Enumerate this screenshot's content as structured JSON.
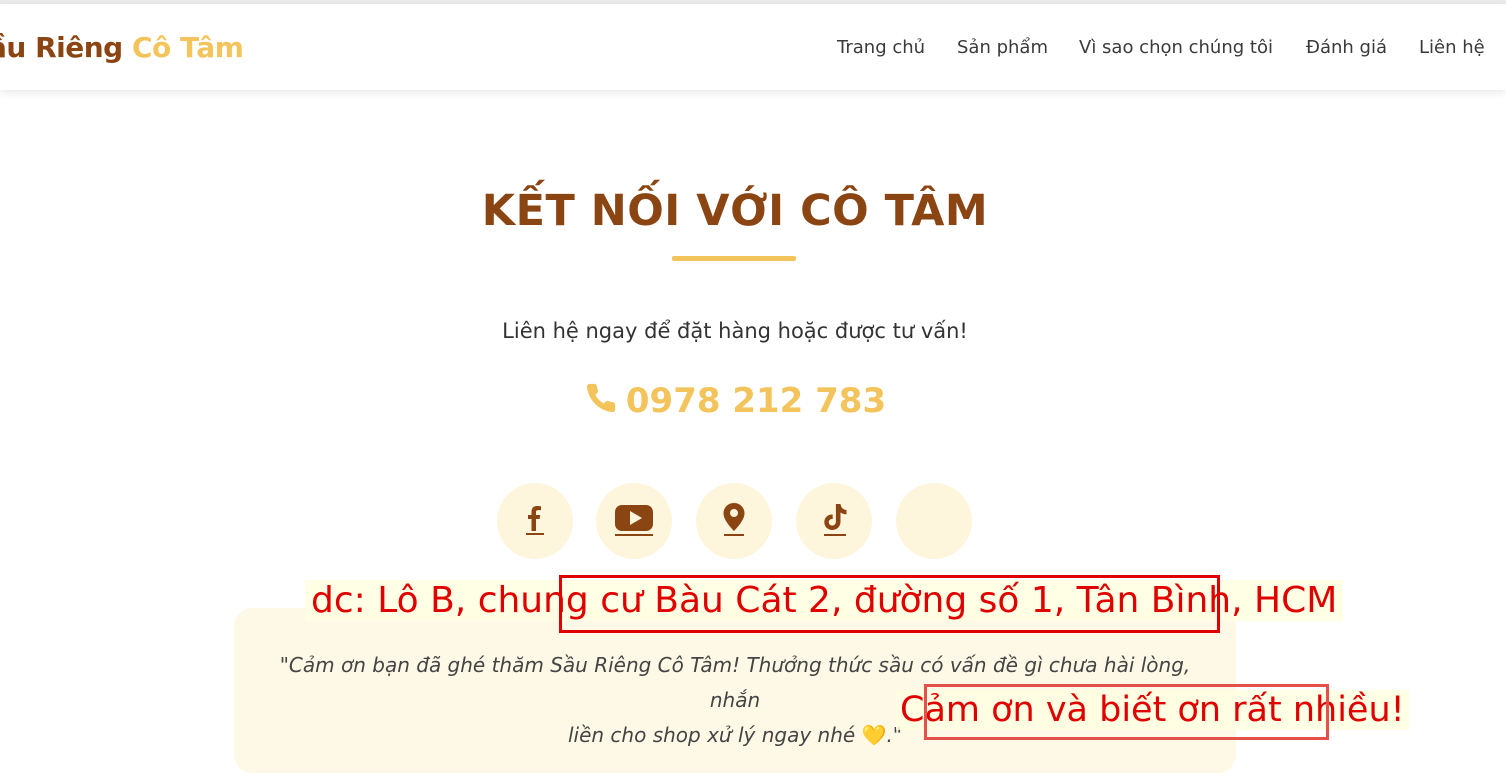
{
  "navbar": {
    "brand_part1": "ầu Riêng",
    "brand_part2": " Cô Tâm",
    "items": [
      {
        "label": "Trang chủ"
      },
      {
        "label": "Sản phẩm"
      },
      {
        "label": "Vì sao chọn chúng tôi"
      },
      {
        "label": "Đánh giá"
      },
      {
        "label": "Liên hệ"
      }
    ]
  },
  "contact": {
    "title": "KẾT NỐI VỚI CÔ TÂM",
    "subtitle": "Liên hệ ngay để đặt hàng hoặc được tư vấn!",
    "phone": "0978 212 783",
    "socials": [
      {
        "icon": "facebook-icon"
      },
      {
        "icon": "youtube-icon"
      },
      {
        "icon": "location-pin-icon"
      },
      {
        "icon": "tiktok-icon"
      },
      {
        "icon": "blank"
      }
    ]
  },
  "quote": {
    "line1": "\"Cảm ơn bạn đã ghé thăm Sầu Riêng Cô Tâm! Thưởng thức sầu có vấn đề gì chưa hài lòng, nhắn",
    "line2": "liền cho shop xử lý ngay nhé",
    "heart": "💛",
    "end": ".\""
  },
  "annotations": {
    "address": "dc: Lô B, chung cư Bàu Cát 2, đường số 1, Tân Bình, HCM",
    "thanks": "Cảm ơn và biết ơn rất nhiều!"
  },
  "colors": {
    "brown": "#8b4513",
    "gold": "#f4c45c",
    "annotation_red": "#e00000"
  }
}
